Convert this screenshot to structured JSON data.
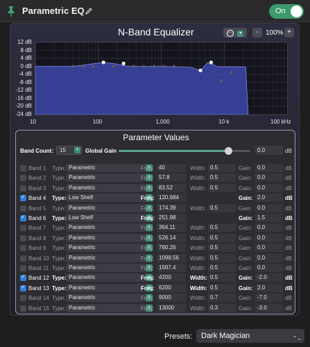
{
  "header": {
    "title": "Parametric EQ",
    "toggle_label": "On"
  },
  "equalizer": {
    "title": "N-Band Equalizer",
    "zoom": "100%",
    "zoom_minus": "-",
    "zoom_plus": "+",
    "options_icon": "ellipsis-icon"
  },
  "chart_data": {
    "type": "line",
    "y_ticks": [
      "12 dB",
      "8 dB",
      "4 dB",
      "0 dB",
      "-4 dB",
      "-8 dB",
      "-12 dB",
      "-16 dB",
      "-20 dB",
      "-24 dB"
    ],
    "x_ticks": [
      "10",
      "100",
      "1,000",
      "10 k",
      "100 kHz"
    ],
    "xlim": [
      10,
      100000
    ],
    "ylim": [
      -24,
      12
    ],
    "x_scale": "log",
    "grid": true,
    "series": [
      {
        "x": [
          10,
          40,
          120,
          170,
          300,
          1000,
          3000,
          4200,
          5500,
          8000,
          14000,
          22000,
          24000
        ],
        "y": [
          0.0,
          0.0,
          2.0,
          1.5,
          0.0,
          0.0,
          -0.5,
          -2.0,
          2.0,
          -0.2,
          -0.2,
          -0.3,
          -24.0
        ]
      }
    ],
    "handles": [
      {
        "x": 40,
        "y": 0
      },
      {
        "x": 57.8,
        "y": 0
      },
      {
        "x": 83.52,
        "y": 0
      },
      {
        "x": 120.684,
        "y": 2.0
      },
      {
        "x": 174.39,
        "y": 0
      },
      {
        "x": 251.98,
        "y": 1.5
      },
      {
        "x": 364.11,
        "y": 0
      },
      {
        "x": 526.14,
        "y": 0
      },
      {
        "x": 760.26,
        "y": 0
      },
      {
        "x": 1098.56,
        "y": 0
      },
      {
        "x": 1587.4,
        "y": 0
      },
      {
        "x": 4200,
        "y": -2.0
      },
      {
        "x": 6200,
        "y": 2.0
      },
      {
        "x": 9000,
        "y": -7.0
      },
      {
        "x": 13000,
        "y": -3.0
      }
    ]
  },
  "params": {
    "title": "Parameter Values",
    "band_count_label": "Band Count:",
    "band_count": "15",
    "global_gain_label": "Global Gain",
    "global_gain": "0.0",
    "global_gain_level": 0.83,
    "unit_db": "dB",
    "type_label": "Type:",
    "freq_label": "Freq:",
    "width_label": "Width:",
    "gain_label": "Gain:",
    "bands": [
      {
        "name": "Band 1",
        "on": false,
        "type": "Parametric",
        "freq": "40",
        "width": "0.5",
        "gain": "0.0"
      },
      {
        "name": "Band 2",
        "on": false,
        "type": "Parametric",
        "freq": "57.8",
        "width": "0.5",
        "gain": "0.0"
      },
      {
        "name": "Band 3",
        "on": false,
        "type": "Parametric",
        "freq": "83.52",
        "width": "0.5",
        "gain": "0.0"
      },
      {
        "name": "Band 4",
        "on": true,
        "type": "Low Shelf",
        "freq": "120.684",
        "width": "",
        "gain": "2.0"
      },
      {
        "name": "Band 5",
        "on": false,
        "type": "Parametric",
        "freq": "174.39",
        "width": "0.5",
        "gain": "0.0"
      },
      {
        "name": "Band 6",
        "on": true,
        "type": "Low Shelf",
        "freq": "251.98",
        "width": "",
        "gain": "1.5"
      },
      {
        "name": "Band 7",
        "on": false,
        "type": "Parametric",
        "freq": "364.11",
        "width": "0.5",
        "gain": "0.0"
      },
      {
        "name": "Band 8",
        "on": false,
        "type": "Parametric",
        "freq": "526.14",
        "width": "0.5",
        "gain": "0.0"
      },
      {
        "name": "Band 9",
        "on": false,
        "type": "Parametric",
        "freq": "760.26",
        "width": "0.5",
        "gain": "0.0"
      },
      {
        "name": "Band 10",
        "on": false,
        "type": "Parametric",
        "freq": "1098.56",
        "width": "0.5",
        "gain": "0.0"
      },
      {
        "name": "Band 11",
        "on": false,
        "type": "Parametric",
        "freq": "1587.4",
        "width": "0.5",
        "gain": "0.0"
      },
      {
        "name": "Band 12",
        "on": true,
        "type": "Parametric",
        "freq": "4200",
        "width": "0.5",
        "gain": "-2.0"
      },
      {
        "name": "Band 13",
        "on": true,
        "type": "Parametric",
        "freq": "6200",
        "width": "0.5",
        "gain": "2.0"
      },
      {
        "name": "Band 14",
        "on": false,
        "type": "Parametric",
        "freq": "9000",
        "width": "0.7",
        "gain": "-7.0"
      },
      {
        "name": "Band 15",
        "on": false,
        "type": "Parametric",
        "freq": "13000",
        "width": "0.3",
        "gain": "-3.0"
      }
    ]
  },
  "presets": {
    "label": "Presets:",
    "value": "Dark Magician"
  },
  "colors": {
    "accent": "#3b9b6d",
    "curve_fill": "#3c46a8",
    "checkbox_on": "#2f7fd6"
  }
}
